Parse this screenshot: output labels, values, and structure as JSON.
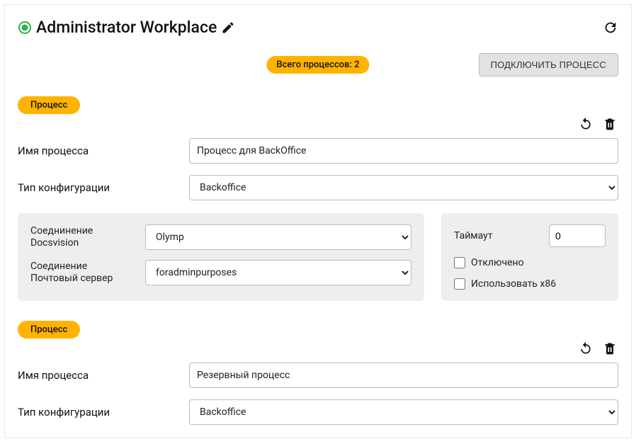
{
  "header": {
    "title": "Administrator Workplace"
  },
  "summary": {
    "total_badge": "Всего процессов: 2",
    "connect_button": "ПОДКЛЮЧИТЬ ПРОЦЕСС"
  },
  "labels": {
    "process_badge": "Процесс",
    "process_name": "Имя процесса",
    "config_type": "Тип конфигурации",
    "conn_docsvision": "Соеднинение Docsvision",
    "conn_mail": "Соединение Почтовый сервер",
    "timeout": "Таймаут",
    "disabled": "Отключено",
    "use_x86": "Использовать x86"
  },
  "processes": [
    {
      "name": "Процесс для BackOffice",
      "config_type": "Backoffice",
      "conn_docsvision": "Olymp",
      "conn_mail": "foradminpurposes",
      "timeout": "0",
      "disabled": false,
      "use_x86": false
    },
    {
      "name": "Резервный процесс",
      "config_type": "Backoffice"
    }
  ]
}
